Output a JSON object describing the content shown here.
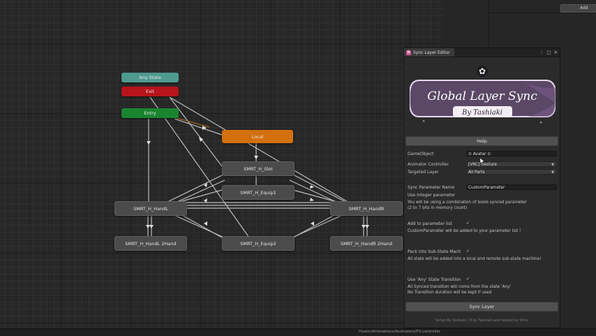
{
  "graph": {
    "nodes": {
      "any_state": "Any State",
      "exit": "Exit",
      "entry": "Entry",
      "local": "Local",
      "sm_slot": "SMRT_H_Slot",
      "sm_equip1": "SMRT_H_Equip1",
      "sm_handl": "SMRT_H_HandL",
      "sm_handr": "SMRT_H_HandR",
      "sm_handl_2hand": "SMRT_H_HandL 2Hand",
      "sm_equip2": "SMRT_H_Equip2",
      "sm_handr_2hand": "SMRT_H_HandR 2Hand"
    }
  },
  "right_panel": {
    "add_button": "Add"
  },
  "status_bar": {
    "path": "Hyeon/Animations/Animators/FX.controller"
  },
  "window": {
    "title": "Sync Layer Editor",
    "banner": {
      "title": "Global Layer Sync",
      "subtitle": "By Tashiaki"
    },
    "help_button": "Help",
    "gameobject_label": "GameObject",
    "gameobject_value": "Avatar",
    "animator_label": "Animator Controller",
    "animator_value": "[VRC] Gesture",
    "layer_label": "Targeted Layer",
    "layer_value": "All Parts",
    "param_label": "Sync Parameter Name",
    "param_value": "CustomParameter",
    "use_integer_label": "Use Integer parameter",
    "use_integer_info_1": "You will be using a combination of bools synced parameter",
    "use_integer_info_2": "(2 to 7 bits in memory count)",
    "add_param_label": "Add to parameter list",
    "add_param_check": "✓",
    "add_param_info": "CustomParameter will be added to your parameter list !",
    "pack_label": "Pack into Sub-State Mach",
    "pack_check": "✓",
    "pack_info": "All state will be added into a local and remote sub-state machine!",
    "any_state_label": "Use 'Any' State Transition",
    "any_state_check": "✓",
    "any_state_info_1": "All Synced transition will come from the state 'Any'",
    "any_state_info_2": "No Transition duration will be kept if used",
    "sync_button": "Sync Layer",
    "footer": "Script By Tashiaki, UI by Tashiaki and helped by Shiro"
  },
  "colors": {
    "any_state": "#4e9a8f",
    "exit": "#b8141b",
    "entry": "#1a8531",
    "local": "#d2700e",
    "state": "#4b4b4b"
  }
}
